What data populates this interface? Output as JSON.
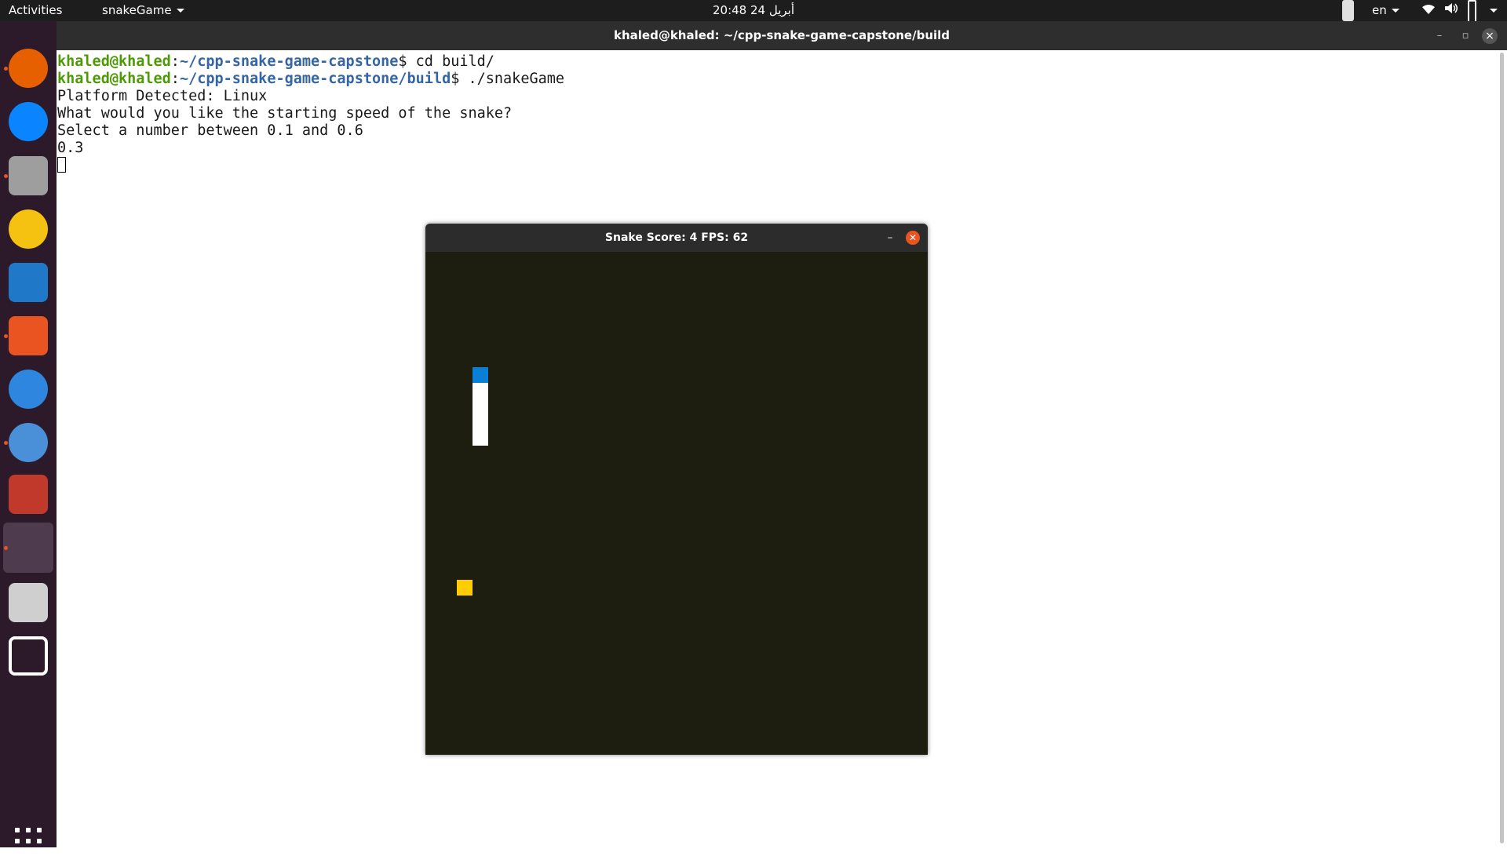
{
  "topbar": {
    "activities": "Activities",
    "app_menu": "snakeGame",
    "clock": "20:48  24 أبريل",
    "language": "en"
  },
  "dock": {
    "items": [
      {
        "name": "firefox-icon",
        "color": "#e66000"
      },
      {
        "name": "thunderbird-icon",
        "color": "#0a84ff"
      },
      {
        "name": "files-icon",
        "color": "#9e9e9e"
      },
      {
        "name": "rhythmbox-icon",
        "color": "#f5c211"
      },
      {
        "name": "libreoffice-writer-icon",
        "color": "#1f78c8"
      },
      {
        "name": "software-center-icon",
        "color": "#e95420"
      },
      {
        "name": "help-icon",
        "color": "#2e86de"
      },
      {
        "name": "chromium-icon",
        "color": "#4a90d9"
      },
      {
        "name": "terminal-app-icon",
        "color": "#c0392b"
      },
      {
        "name": "snakegame-app-icon",
        "color": "#4e3c4e"
      },
      {
        "name": "usb-drive-icon",
        "color": "#cfcfcf"
      },
      {
        "name": "screenshot-icon",
        "color": "#ffffff"
      }
    ],
    "show_apps": "show-applications"
  },
  "terminal": {
    "title": "khaled@khaled: ~/cpp-snake-game-capstone/build",
    "lines": [
      {
        "user": "khaled@khaled",
        "path": "~/cpp-snake-game-capstone",
        "cmd": "$ cd build/"
      },
      {
        "user": "khaled@khaled",
        "path": "~/cpp-snake-game-capstone/build",
        "cmd": "$ ./snakeGame"
      }
    ],
    "output": [
      "Platform Detected: Linux",
      "What would you like the starting speed of the snake?",
      "Select a number between 0.1 and 0.6",
      "0.3"
    ]
  },
  "snake_window": {
    "title": "Snake Score: 4 FPS: 62",
    "colors": {
      "background": "#1e1e10",
      "head": "#0a7fd6",
      "body": "#ffffff",
      "food": "#ffcc00"
    }
  }
}
